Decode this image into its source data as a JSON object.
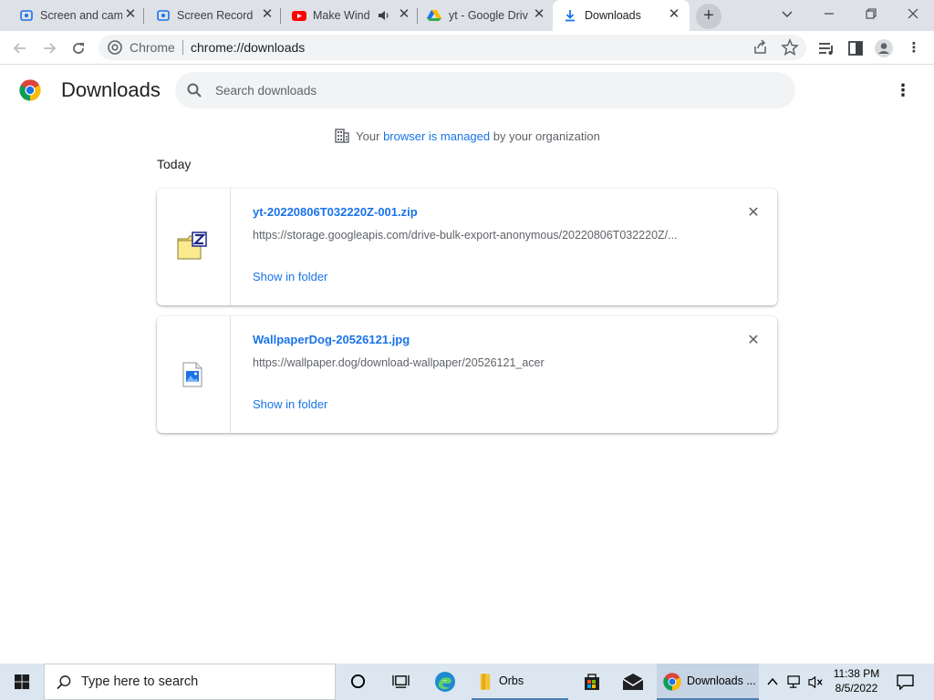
{
  "tabs": [
    {
      "title": "Screen and cam",
      "favicon": "screen-recorder-icon"
    },
    {
      "title": "Screen Recorder",
      "favicon": "screen-recorder-icon"
    },
    {
      "title": "Make Wind",
      "favicon": "youtube-icon",
      "audio": true
    },
    {
      "title": "yt - Google Driv",
      "favicon": "google-drive-icon"
    },
    {
      "title": "Downloads",
      "favicon": "download-icon",
      "active": true
    }
  ],
  "window": {
    "new_tab": "+"
  },
  "omnibox": {
    "scheme": "Chrome",
    "url": "chrome://downloads"
  },
  "page": {
    "title": "Downloads",
    "search_placeholder": "Search downloads",
    "managed_prefix": "Your ",
    "managed_link": "browser is managed",
    "managed_suffix": " by your organization",
    "section_label": "Today"
  },
  "downloads": [
    {
      "file_name": "yt-20220806T032220Z-001.zip",
      "url": "https://storage.googleapis.com/drive-bulk-export-anonymous/20220806T032220Z/...",
      "action": "Show in folder",
      "icon": "zip-file-icon"
    },
    {
      "file_name": "WallpaperDog-20526121.jpg",
      "url": "https://wallpaper.dog/download-wallpaper/20526121_acer",
      "action": "Show in folder",
      "icon": "image-file-icon"
    }
  ],
  "taskbar": {
    "search_text": "Type here to search",
    "apps": [
      {
        "label": "Orbs",
        "icon": "folder-icon"
      },
      {
        "label": "Downloads ...",
        "icon": "chrome-icon"
      }
    ],
    "time": "11:38 PM",
    "date": "8/5/2022"
  },
  "colors": {
    "accent": "#1a73e8",
    "tabstrip": "#dee1e6",
    "taskbar": "#dce6f0"
  }
}
